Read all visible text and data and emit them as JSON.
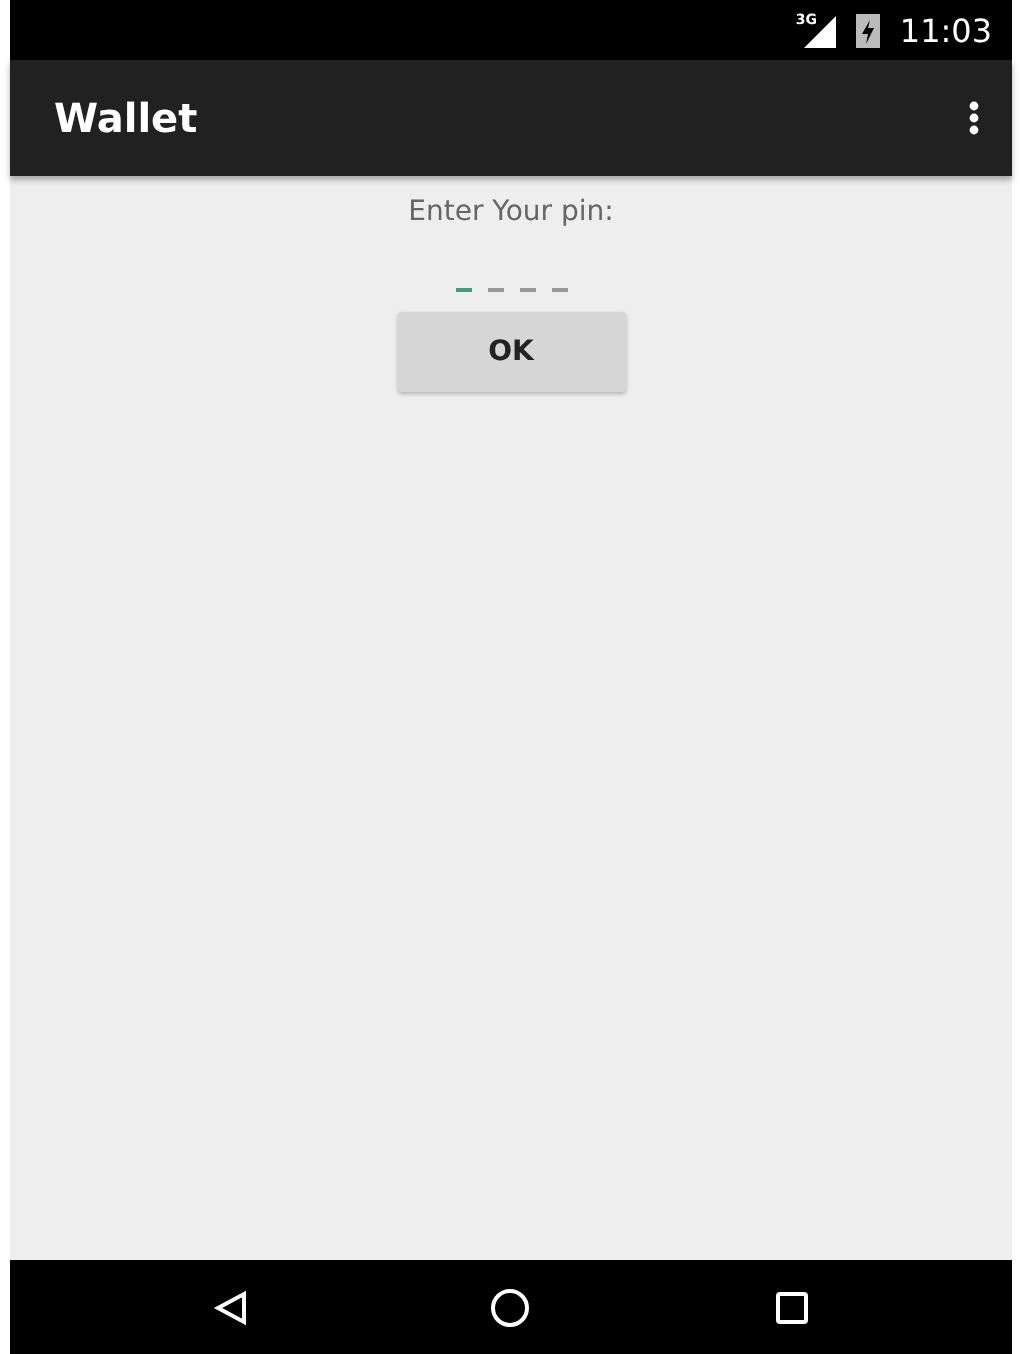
{
  "status_bar": {
    "network": "3G",
    "time": "11:03"
  },
  "app_bar": {
    "title": "Wallet"
  },
  "prompt": "Enter Your pin:",
  "pin": {
    "slots": [
      {
        "selected": true
      },
      {
        "selected": false
      },
      {
        "selected": false
      },
      {
        "selected": false
      }
    ]
  },
  "buttons": [
    "OK"
  ]
}
